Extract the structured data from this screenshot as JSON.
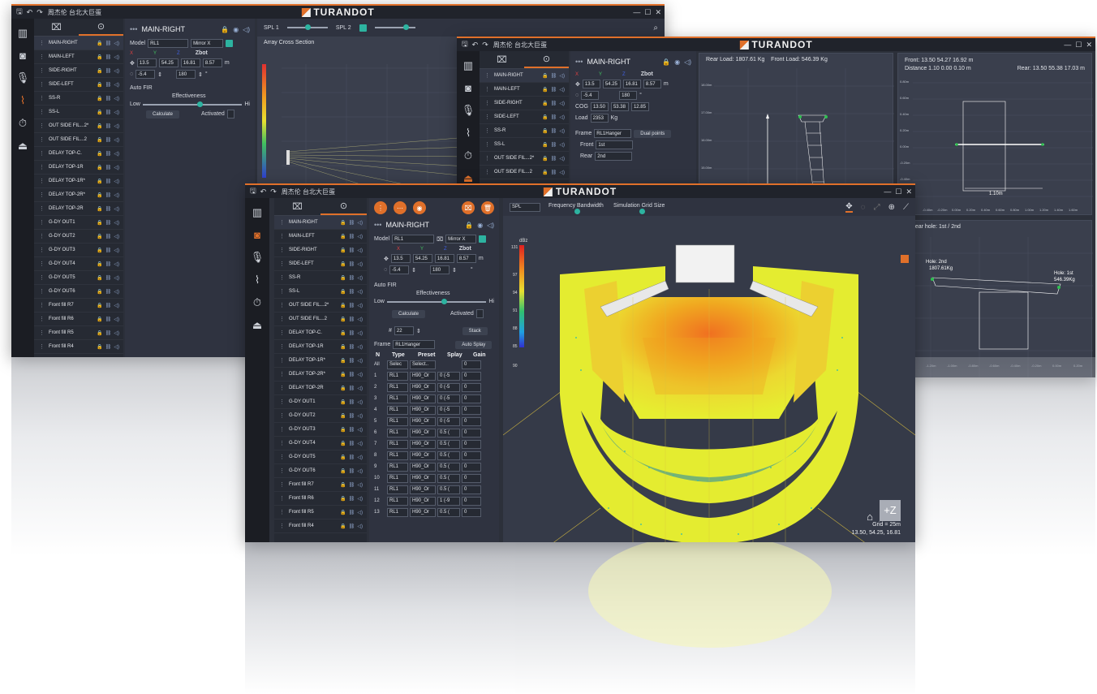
{
  "brand": "TURANDOT",
  "title_text": "周杰伦 台北大巨蛋",
  "window_controls": [
    "—",
    "☐",
    "✕"
  ],
  "tree_items_main": [
    "MAIN-RIGHT",
    "MAIN-LEFT",
    "SIDE-RIGHT",
    "SIDE-LEFT",
    "SS-R",
    "SS-L",
    "OUT SIDE FIL...2*",
    "OUT SIDE FIL...2",
    "DELAY TOP-C.",
    "DELAY TOP-1R",
    "DELAY TOP-1R*",
    "DELAY TOP-2R*",
    "DELAY TOP-2R",
    "G-DY OUT1",
    "G-DY OUT2",
    "G-DY OUT3",
    "G-DY OUT4",
    "G-DY OUT5",
    "G-DY OUT6",
    "Front fill R7",
    "Front fill R6",
    "Front fill R5",
    "Front fill R4"
  ],
  "panel": {
    "name": "MAIN-RIGHT",
    "model_label": "Model",
    "model_value": "RL1",
    "mirror_label": "Mirror X",
    "axis_labels": [
      "X",
      "Y",
      "Z",
      "Zbot"
    ],
    "pos_values": [
      "13.5",
      "54.25",
      "16.81",
      "8.57"
    ],
    "pos_unit": "m",
    "rot_values": [
      "-5.4",
      "180"
    ],
    "rot_unit": "°",
    "auto_fir": "Auto FIR",
    "effectiveness": "Effectiveness",
    "low": "Low",
    "hi": "Hi",
    "effectiveness_level": 0.55,
    "calculate": "Calculate",
    "activated": "Activated",
    "count_label": "#",
    "count_value": "22",
    "stack": "Stack",
    "frame_label": "Frame",
    "frame_value": "RL1Hanger",
    "auto_splay": "Auto Splay",
    "table_headers": [
      "N",
      "Type",
      "Preset",
      "Splay",
      "Gain"
    ],
    "all_row": [
      "All",
      "Selec",
      "Select..",
      "",
      "0"
    ],
    "rows": [
      [
        "1",
        "RL1",
        "H90_Or",
        "0 (-5",
        "0"
      ],
      [
        "2",
        "RL1",
        "H90_Or",
        "0 (-5",
        "0"
      ],
      [
        "3",
        "RL1",
        "H90_Or",
        "0 (-5",
        "0"
      ],
      [
        "4",
        "RL1",
        "H90_Or",
        "0 (-5",
        "0"
      ],
      [
        "5",
        "RL1",
        "H90_Or",
        "0 (-5",
        "0"
      ],
      [
        "6",
        "RL1",
        "H90_Or",
        "0.5 (",
        "0"
      ],
      [
        "7",
        "RL1",
        "H90_Or",
        "0.5 (",
        "0"
      ],
      [
        "8",
        "RL1",
        "H90_Or",
        "0.5 (",
        "0"
      ],
      [
        "9",
        "RL1",
        "H90_Or",
        "0.5 (",
        "0"
      ],
      [
        "10",
        "RL1",
        "H90_Or",
        "0.5 (",
        "0"
      ],
      [
        "11",
        "RL1",
        "H90_Or",
        "0.5 (",
        "0"
      ],
      [
        "12",
        "RL1",
        "H90_Or",
        "1 (-9",
        "0"
      ],
      [
        "13",
        "RL1",
        "H90_Or",
        "0.5 (",
        "0"
      ]
    ]
  },
  "back_window": {
    "spl1": "SPL 1",
    "spl2": "SPL 2",
    "section_title": "Array Cross Section",
    "scale_ticks": [
      "112",
      "45",
      "40",
      "35",
      "30",
      "25",
      "20",
      "15",
      "10",
      "5",
      "0",
      "-5",
      "102"
    ]
  },
  "mid_window": {
    "cog_label": "COG",
    "cog_values": [
      "13.50",
      "53.38",
      "12.85"
    ],
    "load_label": "Load",
    "load_value": "2353",
    "load_unit": "Kg",
    "dual_points": "Dual points",
    "front_label": "Front",
    "front_value": "1st",
    "rear_label": "Rear",
    "rear_value": "2nd",
    "rear_load": "Rear Load:  1807.61  Kg",
    "front_load": "Front Load:  546.39  Kg",
    "front_coords": "Front: 13.50 54.27 16.92 m",
    "distance": "Distance 1.10 0.00 0.10 m",
    "rear_coords": "Rear: 13.50 55.38 17.03 m",
    "width_label": "1.10m",
    "hole_title": "nt/Rear hole: 1st / 2nd",
    "hole2": "Hole: 2nd",
    "hole2_kg": "1807.61Kg",
    "hole1": "Hole: 1st",
    "hole1_kg": "546.39Kg",
    "y_ticks": [
      "18.00m",
      "17.00m",
      "16.00m",
      "15.00m"
    ],
    "y_ticks2": [
      "0.80m",
      "0.60m",
      "0.40m",
      "0.20m",
      "0.00m",
      "-0.20m",
      "-0.40m",
      "-0.60m"
    ],
    "x_ticks2": [
      "-0.40m",
      "-0.20m",
      "0.00m",
      "0.20m",
      "0.40m",
      "0.60m",
      "0.80m",
      "1.00m",
      "1.20m",
      "1.40m",
      "1.60m"
    ],
    "x_ticks3": [
      "-1.20m",
      "-1.00m",
      "-0.80m",
      "-0.60m",
      "-0.40m",
      "-0.20m",
      "0.00m",
      "0.20m"
    ]
  },
  "front_window": {
    "view_mode": "SPL",
    "freq_bw": "Frequency Bandwidth",
    "grid_size": "Simulation Grid Size",
    "db_label": "dBz",
    "db_ticks": [
      "131",
      "97",
      "94",
      "91",
      "88",
      "85",
      "90"
    ],
    "grid_label": "Grid = 25m",
    "coords": "13.50, 54.25, 16.81",
    "plus_z": "+Z"
  },
  "colors": {
    "accent": "#e0702a",
    "teal": "#2db3a0",
    "panel": "#2f3340",
    "dark": "#1b1d23"
  }
}
